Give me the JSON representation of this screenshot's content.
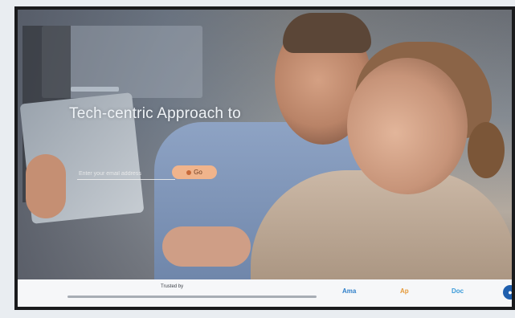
{
  "hero": {
    "headline": "Tech-centric Approach to",
    "email_placeholder": "Enter your email address",
    "cta_label": "Go"
  },
  "logo_strip": {
    "title": "Trusted by",
    "partners": [
      "Ama",
      "Ap",
      "Doc"
    ]
  },
  "colors": {
    "cta_background": "#f0b48c",
    "strip_background": "#f6f7f9",
    "partner_badge": "#1f5fae"
  },
  "icons": {
    "cta_icon": "dot-icon",
    "partner_badge_icon": "circle-logo-icon"
  }
}
